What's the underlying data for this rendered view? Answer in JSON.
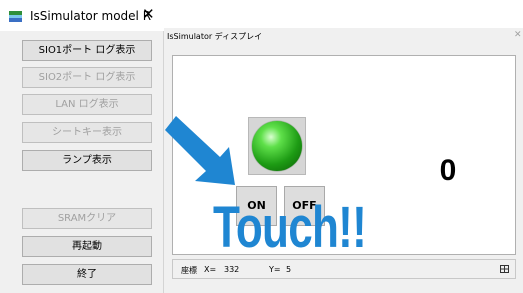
{
  "panel": {
    "title": "IsSimulator model R",
    "close_glyph": "✕",
    "buttons": [
      {
        "label": "SIO1ポート ログ表示",
        "enabled": true
      },
      {
        "label": "SIO2ポート ログ表示",
        "enabled": false
      },
      {
        "label": "LAN ログ表示",
        "enabled": false
      },
      {
        "label": "シートキー表示",
        "enabled": false
      },
      {
        "label": "ランプ表示",
        "enabled": true
      },
      {
        "label": "SRAMクリア",
        "enabled": false
      },
      {
        "label": "再起動",
        "enabled": true
      },
      {
        "label": "終了",
        "enabled": true
      }
    ]
  },
  "display": {
    "title": "IsSimulator ディスプレイ",
    "close_glyph": "✕",
    "lamp": {
      "state": "on",
      "color": "#2bb21e"
    },
    "on_button": "ON",
    "off_button": "OFF",
    "counter": "0",
    "status": {
      "coord_label": "座標",
      "x_label": "X=",
      "x_value": "332",
      "y_label": "Y=",
      "y_value": "5",
      "icon": "grid-icon"
    }
  },
  "overlay": {
    "arrow_color": "#1f86d2",
    "touch_text": "Touch!!"
  }
}
